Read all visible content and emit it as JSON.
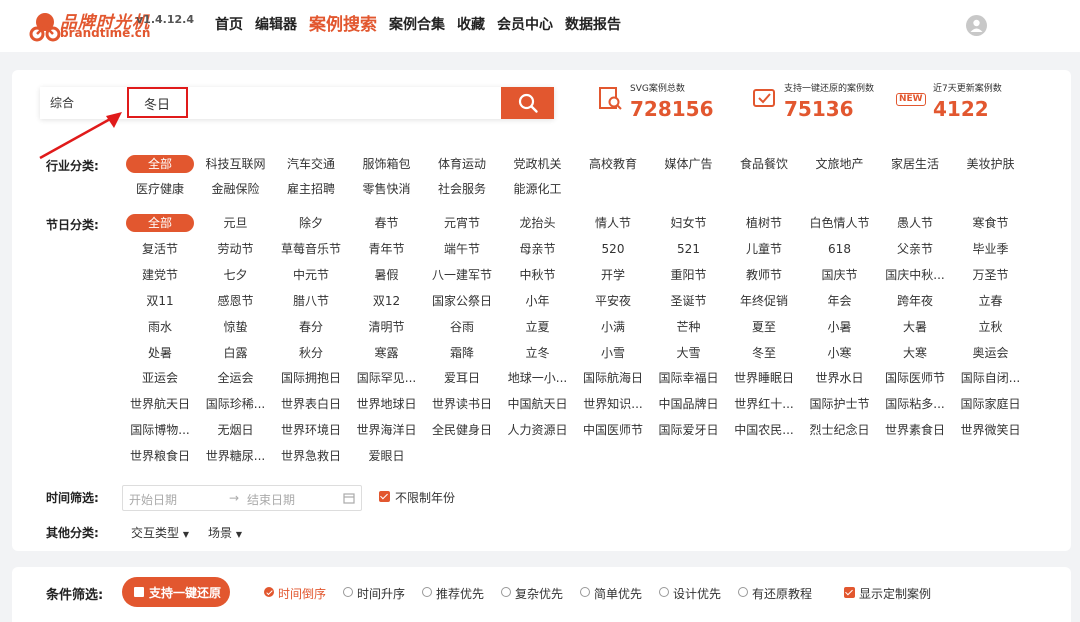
{
  "brand": {
    "name_cn": "品牌时光机",
    "version": "v1.4.12.4",
    "domain": "brandtime.cn"
  },
  "nav": {
    "items": [
      "首页",
      "编辑器",
      "案例搜索",
      "案例合集",
      "收藏",
      "会员中心",
      "数据报告"
    ],
    "active_index": 2
  },
  "search": {
    "type": "综合",
    "value": "冬日"
  },
  "stats": [
    {
      "label": "SVG案例总数",
      "value": "728156",
      "icon": "document-search-icon"
    },
    {
      "label": "支持一键还原的案例数",
      "value": "75136",
      "icon": "restore-icon"
    },
    {
      "label": "近7天更新案例数",
      "value": "4122",
      "badge": "NEW"
    }
  ],
  "industry": {
    "label": "行业分类:",
    "tags": [
      "全部",
      "科技互联网",
      "汽车交通",
      "服饰箱包",
      "体育运动",
      "党政机关",
      "高校教育",
      "媒体广告",
      "食品餐饮",
      "文旅地产",
      "家居生活",
      "美妆护肤",
      "医疗健康",
      "金融保险",
      "雇主招聘",
      "零售快消",
      "社会服务",
      "能源化工"
    ],
    "selected_index": 0
  },
  "festival": {
    "label": "节日分类:",
    "tags": [
      "全部",
      "元旦",
      "除夕",
      "春节",
      "元宵节",
      "龙抬头",
      "情人节",
      "妇女节",
      "植树节",
      "白色情人节",
      "愚人节",
      "寒食节",
      "复活节",
      "劳动节",
      "草莓音乐节",
      "青年节",
      "端午节",
      "母亲节",
      "520",
      "521",
      "儿童节",
      "618",
      "父亲节",
      "毕业季",
      "建党节",
      "七夕",
      "中元节",
      "暑假",
      "八一建军节",
      "中秋节",
      "开学",
      "重阳节",
      "教师节",
      "国庆节",
      "国庆中秋...",
      "万圣节",
      "双11",
      "感恩节",
      "腊八节",
      "双12",
      "国家公祭日",
      "小年",
      "平安夜",
      "圣诞节",
      "年终促销",
      "年会",
      "跨年夜",
      "立春",
      "雨水",
      "惊蛰",
      "春分",
      "清明节",
      "谷雨",
      "立夏",
      "小满",
      "芒种",
      "夏至",
      "小暑",
      "大暑",
      "立秋",
      "处暑",
      "白露",
      "秋分",
      "寒露",
      "霜降",
      "立冬",
      "小雪",
      "大雪",
      "冬至",
      "小寒",
      "大寒",
      "奥运会",
      "亚运会",
      "全运会",
      "国际拥抱日",
      "国际罕见...",
      "爱耳日",
      "地球一小...",
      "国际航海日",
      "国际幸福日",
      "世界睡眠日",
      "世界水日",
      "国际医师节",
      "国际自闭...",
      "世界航天日",
      "国际珍稀...",
      "世界表白日",
      "世界地球日",
      "世界读书日",
      "中国航天日",
      "世界知识...",
      "中国品牌日",
      "世界红十...",
      "国际护士节",
      "国际粘多...",
      "国际家庭日",
      "国际博物...",
      "无烟日",
      "世界环境日",
      "世界海洋日",
      "全民健身日",
      "人力资源日",
      "中国医师节",
      "国际爱牙日",
      "中国农民...",
      "烈士纪念日",
      "世界素食日",
      "世界微笑日",
      "世界粮食日",
      "世界糖尿...",
      "世界急救日",
      "爱眼日"
    ],
    "selected_index": 0
  },
  "time_filter": {
    "label": "时间筛选:",
    "start_placeholder": "开始日期",
    "arrow": "→",
    "end_placeholder": "结束日期",
    "unlimited_year": "不限制年份"
  },
  "other": {
    "label": "其他分类:",
    "dropdowns": [
      "交互类型",
      "场景"
    ]
  },
  "conditions": {
    "label": "条件筛选:",
    "one_click_restore": "支持一键还原",
    "options": [
      "时间倒序",
      "时间升序",
      "推荐优先",
      "复杂优先",
      "简单优先",
      "设计优先",
      "有还原教程"
    ],
    "selected_option_index": 0,
    "show_custom": "显示定制案例"
  },
  "colors": {
    "accent": "#e2572f",
    "annotation": "#e01a1a"
  }
}
